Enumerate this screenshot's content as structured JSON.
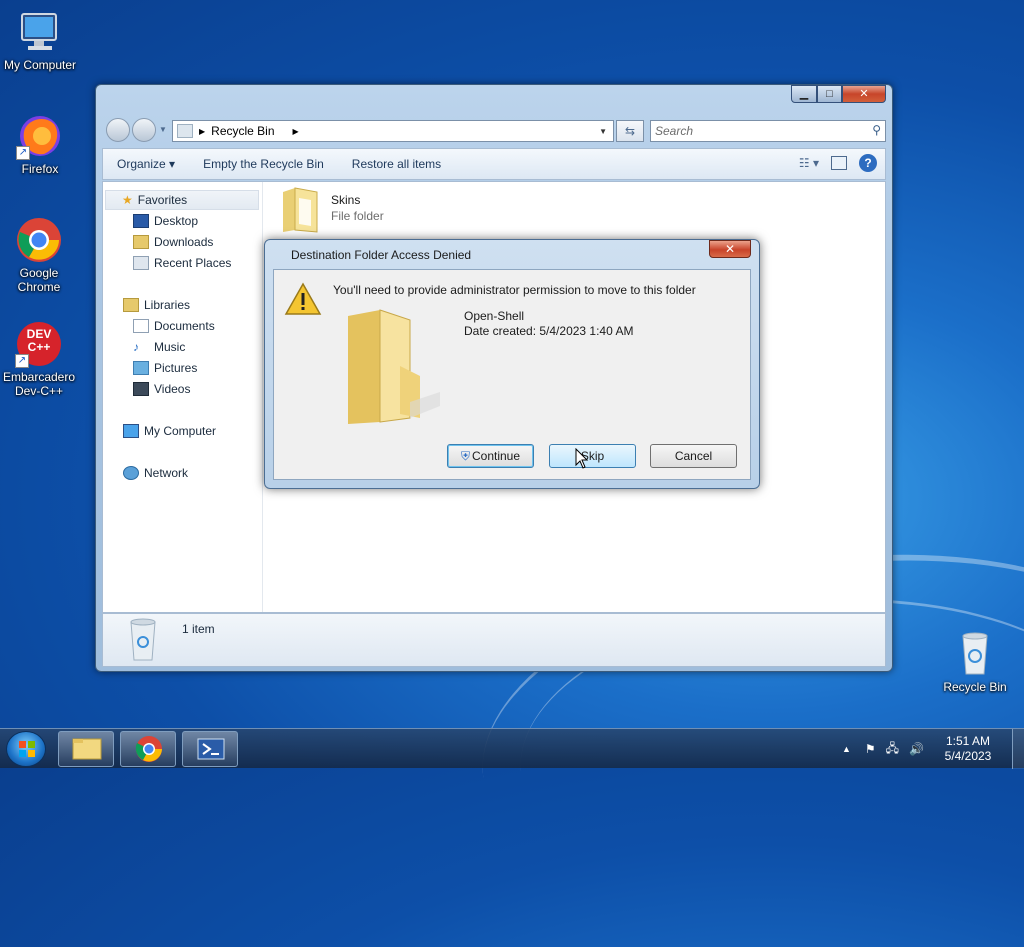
{
  "desktop": {
    "icons": [
      {
        "label": "My Computer",
        "icon": "computer-icon"
      },
      {
        "label": "Firefox",
        "icon": "firefox-icon"
      },
      {
        "label": "Google Chrome",
        "icon": "chrome-icon"
      },
      {
        "label": "Embarcadero Dev-C++",
        "icon": "devcpp-icon"
      },
      {
        "label": "Recycle Bin",
        "icon": "recycle-bin-icon"
      }
    ],
    "devcpp_logo_text": "DEV C++"
  },
  "explorer": {
    "address": {
      "location": "Recycle Bin"
    },
    "search": {
      "placeholder": "Search"
    },
    "commands": {
      "organize": "Organize",
      "empty": "Empty the Recycle Bin",
      "restore": "Restore all items"
    },
    "nav": {
      "favorites": "Favorites",
      "desktop": "Desktop",
      "downloads": "Downloads",
      "recent": "Recent Places",
      "libraries": "Libraries",
      "documents": "Documents",
      "music": "Music",
      "pictures": "Pictures",
      "videos": "Videos",
      "computer": "My Computer",
      "network": "Network"
    },
    "files": [
      {
        "name": "Skins",
        "type": "File folder"
      }
    ],
    "details": {
      "count": "1 item"
    }
  },
  "dialog": {
    "title": "Destination Folder Access Denied",
    "message": "You'll need to provide administrator permission to move to this folder",
    "item_name": "Open-Shell",
    "item_date": "Date created: 5/4/2023 1:40 AM",
    "buttons": {
      "continue": "Continue",
      "skip": "Skip",
      "cancel": "Cancel"
    }
  },
  "taskbar": {
    "time": "1:51 AM",
    "date": "5/4/2023"
  },
  "colors": {
    "accent": "#1b6fc9",
    "dialog_frame": "#b8d0e8",
    "close_red": "#c9442a"
  }
}
